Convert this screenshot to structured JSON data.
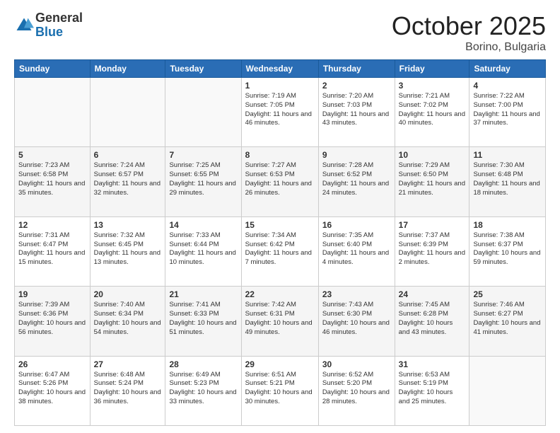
{
  "logo": {
    "general": "General",
    "blue": "Blue"
  },
  "title": "October 2025",
  "location": "Borino, Bulgaria",
  "days_of_week": [
    "Sunday",
    "Monday",
    "Tuesday",
    "Wednesday",
    "Thursday",
    "Friday",
    "Saturday"
  ],
  "weeks": [
    [
      {
        "day": "",
        "info": ""
      },
      {
        "day": "",
        "info": ""
      },
      {
        "day": "",
        "info": ""
      },
      {
        "day": "1",
        "info": "Sunrise: 7:19 AM\nSunset: 7:05 PM\nDaylight: 11 hours and 46 minutes."
      },
      {
        "day": "2",
        "info": "Sunrise: 7:20 AM\nSunset: 7:03 PM\nDaylight: 11 hours and 43 minutes."
      },
      {
        "day": "3",
        "info": "Sunrise: 7:21 AM\nSunset: 7:02 PM\nDaylight: 11 hours and 40 minutes."
      },
      {
        "day": "4",
        "info": "Sunrise: 7:22 AM\nSunset: 7:00 PM\nDaylight: 11 hours and 37 minutes."
      }
    ],
    [
      {
        "day": "5",
        "info": "Sunrise: 7:23 AM\nSunset: 6:58 PM\nDaylight: 11 hours and 35 minutes."
      },
      {
        "day": "6",
        "info": "Sunrise: 7:24 AM\nSunset: 6:57 PM\nDaylight: 11 hours and 32 minutes."
      },
      {
        "day": "7",
        "info": "Sunrise: 7:25 AM\nSunset: 6:55 PM\nDaylight: 11 hours and 29 minutes."
      },
      {
        "day": "8",
        "info": "Sunrise: 7:27 AM\nSunset: 6:53 PM\nDaylight: 11 hours and 26 minutes."
      },
      {
        "day": "9",
        "info": "Sunrise: 7:28 AM\nSunset: 6:52 PM\nDaylight: 11 hours and 24 minutes."
      },
      {
        "day": "10",
        "info": "Sunrise: 7:29 AM\nSunset: 6:50 PM\nDaylight: 11 hours and 21 minutes."
      },
      {
        "day": "11",
        "info": "Sunrise: 7:30 AM\nSunset: 6:48 PM\nDaylight: 11 hours and 18 minutes."
      }
    ],
    [
      {
        "day": "12",
        "info": "Sunrise: 7:31 AM\nSunset: 6:47 PM\nDaylight: 11 hours and 15 minutes."
      },
      {
        "day": "13",
        "info": "Sunrise: 7:32 AM\nSunset: 6:45 PM\nDaylight: 11 hours and 13 minutes."
      },
      {
        "day": "14",
        "info": "Sunrise: 7:33 AM\nSunset: 6:44 PM\nDaylight: 11 hours and 10 minutes."
      },
      {
        "day": "15",
        "info": "Sunrise: 7:34 AM\nSunset: 6:42 PM\nDaylight: 11 hours and 7 minutes."
      },
      {
        "day": "16",
        "info": "Sunrise: 7:35 AM\nSunset: 6:40 PM\nDaylight: 11 hours and 4 minutes."
      },
      {
        "day": "17",
        "info": "Sunrise: 7:37 AM\nSunset: 6:39 PM\nDaylight: 11 hours and 2 minutes."
      },
      {
        "day": "18",
        "info": "Sunrise: 7:38 AM\nSunset: 6:37 PM\nDaylight: 10 hours and 59 minutes."
      }
    ],
    [
      {
        "day": "19",
        "info": "Sunrise: 7:39 AM\nSunset: 6:36 PM\nDaylight: 10 hours and 56 minutes."
      },
      {
        "day": "20",
        "info": "Sunrise: 7:40 AM\nSunset: 6:34 PM\nDaylight: 10 hours and 54 minutes."
      },
      {
        "day": "21",
        "info": "Sunrise: 7:41 AM\nSunset: 6:33 PM\nDaylight: 10 hours and 51 minutes."
      },
      {
        "day": "22",
        "info": "Sunrise: 7:42 AM\nSunset: 6:31 PM\nDaylight: 10 hours and 49 minutes."
      },
      {
        "day": "23",
        "info": "Sunrise: 7:43 AM\nSunset: 6:30 PM\nDaylight: 10 hours and 46 minutes."
      },
      {
        "day": "24",
        "info": "Sunrise: 7:45 AM\nSunset: 6:28 PM\nDaylight: 10 hours and 43 minutes."
      },
      {
        "day": "25",
        "info": "Sunrise: 7:46 AM\nSunset: 6:27 PM\nDaylight: 10 hours and 41 minutes."
      }
    ],
    [
      {
        "day": "26",
        "info": "Sunrise: 6:47 AM\nSunset: 5:26 PM\nDaylight: 10 hours and 38 minutes."
      },
      {
        "day": "27",
        "info": "Sunrise: 6:48 AM\nSunset: 5:24 PM\nDaylight: 10 hours and 36 minutes."
      },
      {
        "day": "28",
        "info": "Sunrise: 6:49 AM\nSunset: 5:23 PM\nDaylight: 10 hours and 33 minutes."
      },
      {
        "day": "29",
        "info": "Sunrise: 6:51 AM\nSunset: 5:21 PM\nDaylight: 10 hours and 30 minutes."
      },
      {
        "day": "30",
        "info": "Sunrise: 6:52 AM\nSunset: 5:20 PM\nDaylight: 10 hours and 28 minutes."
      },
      {
        "day": "31",
        "info": "Sunrise: 6:53 AM\nSunset: 5:19 PM\nDaylight: 10 hours and 25 minutes."
      },
      {
        "day": "",
        "info": ""
      }
    ]
  ]
}
